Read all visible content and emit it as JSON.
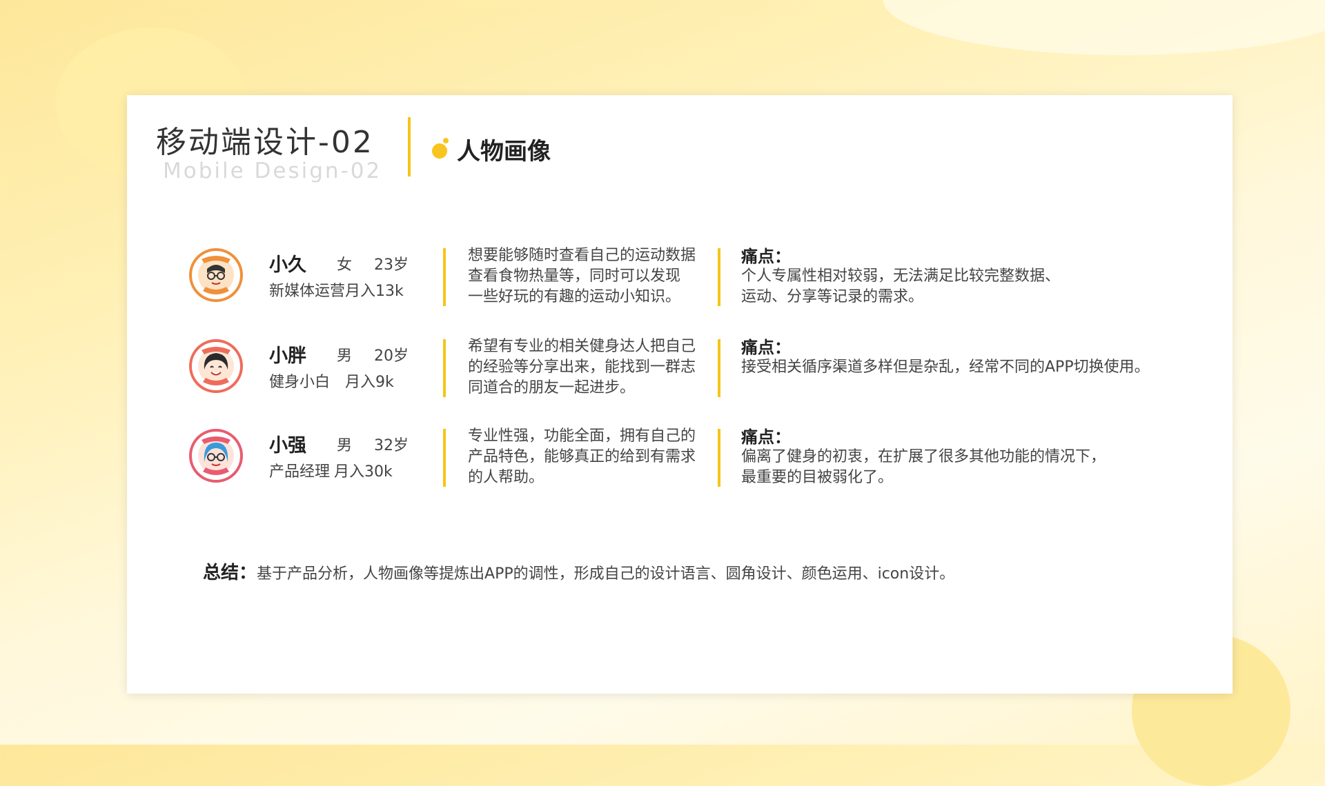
{
  "header": {
    "title": "移动端设计-02",
    "subtitle": "Mobile Design-02",
    "section_title": "人物画像"
  },
  "colors": {
    "accent": "#f5c518",
    "text": "#333333",
    "muted": "#d9d9d9"
  },
  "personas": [
    {
      "name": "小久",
      "gender": "女",
      "age": "23岁",
      "job": "新媒体运营",
      "income": "月入13k",
      "avatar_icon": "avatar-woman-glasses-icon",
      "needs_lines": [
        "想要能够随时查看自己的运动数据",
        "查看食物热量等，同时可以发现",
        "一些好玩的有趣的运动小知识。"
      ],
      "pain_title": "痛点：",
      "pain_lines": [
        "个人专属性相对较弱，无法满足比较完整数据、",
        "运动、分享等记录的需求。"
      ]
    },
    {
      "name": "小胖",
      "gender": "男",
      "age": "20岁",
      "job": "健身小白",
      "income": "月入9k",
      "avatar_icon": "avatar-smiling-woman-icon",
      "needs_lines": [
        "希望有专业的相关健身达人把自己",
        "的经验等分享出来，能找到一群志",
        "同道合的朋友一起进步。"
      ],
      "pain_title": "痛点：",
      "pain_lines": [
        "接受相关循序渠道多样但是杂乱，经常不同的APP切换使用。"
      ]
    },
    {
      "name": "小强",
      "gender": "男",
      "age": "32岁",
      "job": "产品经理",
      "income": "月入30k",
      "avatar_icon": "avatar-woman-blue-icon",
      "needs_lines": [
        "专业性强，功能全面，拥有自己的",
        "产品特色，能够真正的给到有需求",
        "的人帮助。"
      ],
      "pain_title": "痛点：",
      "pain_lines": [
        "偏离了健身的初衷，在扩展了很多其他功能的情况下，",
        "最重要的目被弱化了。"
      ]
    }
  ],
  "summary": {
    "label": "总结：",
    "text": "基于产品分析，人物画像等提炼出APP的调性，形成自己的设计语言、圆角设计、颜色运用、icon设计。"
  }
}
